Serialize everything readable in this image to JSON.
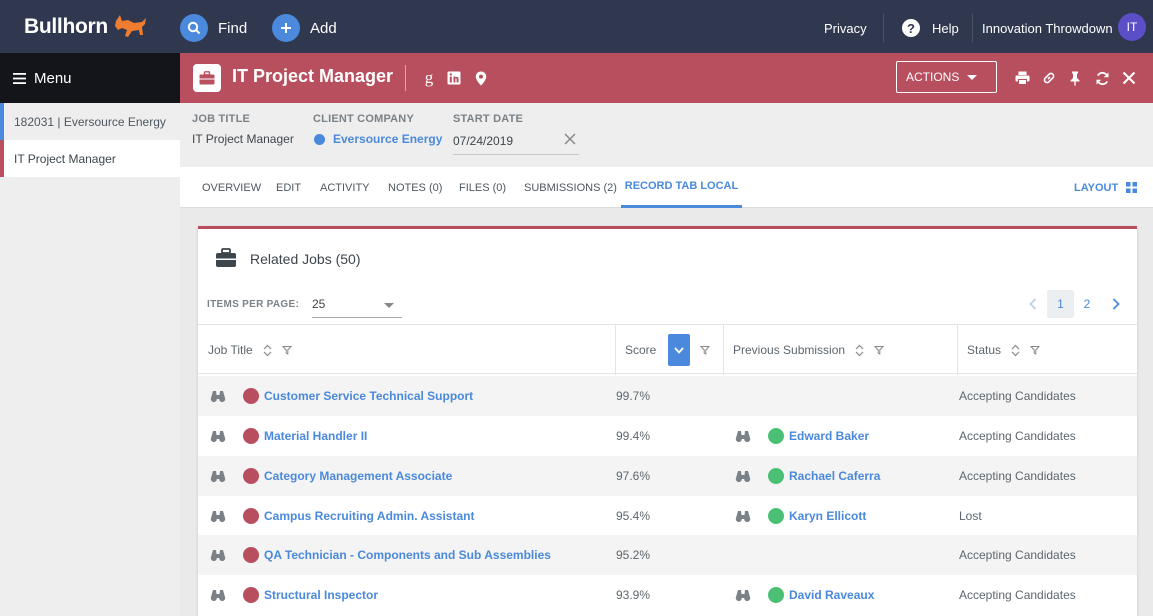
{
  "topbar": {
    "brand": "Bullhorn",
    "find_label": "Find",
    "add_label": "Add",
    "privacy_label": "Privacy",
    "help_label": "Help",
    "user_name": "Innovation Throwdown",
    "user_initials": "IT"
  },
  "sidebar": {
    "menu_label": "Menu",
    "items": [
      {
        "label": "182031 | Eversource Energy"
      },
      {
        "label": "IT Project Manager"
      }
    ]
  },
  "record": {
    "title": "IT Project Manager",
    "actions_label": "ACTIONS",
    "fields": {
      "job_title_label": "JOB TITLE",
      "job_title_value": "IT Project Manager",
      "client_company_label": "CLIENT COMPANY",
      "client_company_value": "Eversource Energy",
      "start_date_label": "START DATE",
      "start_date_value": "07/24/2019"
    }
  },
  "tabs": {
    "items": [
      {
        "label": "OVERVIEW"
      },
      {
        "label": "EDIT"
      },
      {
        "label": "ACTIVITY"
      },
      {
        "label": "NOTES (0)"
      },
      {
        "label": "FILES (0)"
      },
      {
        "label": "SUBMISSIONS (2)"
      },
      {
        "label": "RECORD TAB LOCAL"
      }
    ],
    "active": "RECORD TAB LOCAL",
    "layout_label": "LAYOUT"
  },
  "related_jobs": {
    "title": "Related Jobs (50)",
    "items_per_page_label": "ITEMS PER PAGE:",
    "items_per_page_value": "25",
    "pages": [
      "1",
      "2"
    ],
    "current_page": "1",
    "columns": [
      "Job Title",
      "Score",
      "Previous Submission",
      "Status"
    ],
    "rows": [
      {
        "job_title": "Customer Service Technical Support",
        "score": "99.7%",
        "previous_submission": "",
        "status": "Accepting Candidates"
      },
      {
        "job_title": "Material Handler II",
        "score": "99.4%",
        "previous_submission": "Edward Baker",
        "status": "Accepting Candidates"
      },
      {
        "job_title": "Category Management Associate",
        "score": "97.6%",
        "previous_submission": "Rachael Caferra",
        "status": "Accepting Candidates"
      },
      {
        "job_title": "Campus Recruiting Admin. Assistant",
        "score": "95.4%",
        "previous_submission": "Karyn Ellicott",
        "status": "Lost"
      },
      {
        "job_title": "QA Technician - Components and Sub Assemblies",
        "score": "95.2%",
        "previous_submission": "",
        "status": "Accepting Candidates"
      },
      {
        "job_title": "Structural Inspector",
        "score": "93.9%",
        "previous_submission": "David Raveaux",
        "status": "Accepting Candidates"
      }
    ]
  },
  "colors": {
    "topbar": "#2f384f",
    "record_header": "#b84f5f",
    "link": "#4a89dc",
    "job_dot": "#b84f5f",
    "candidate_dot": "#4bbf73",
    "brand_accent": "#f07d2f"
  },
  "icons": {
    "find": "search-icon",
    "add": "plus-icon",
    "help": "help-icon",
    "menu": "hamburger-icon",
    "record": "briefcase-icon",
    "header_links": [
      "google-icon",
      "linkedin-icon",
      "map-pin-icon"
    ],
    "toolbar": [
      "print-icon",
      "link-icon",
      "pin-icon",
      "refresh-icon",
      "close-icon"
    ],
    "layout": "grid-icon",
    "row_preview": "binoculars-icon"
  }
}
